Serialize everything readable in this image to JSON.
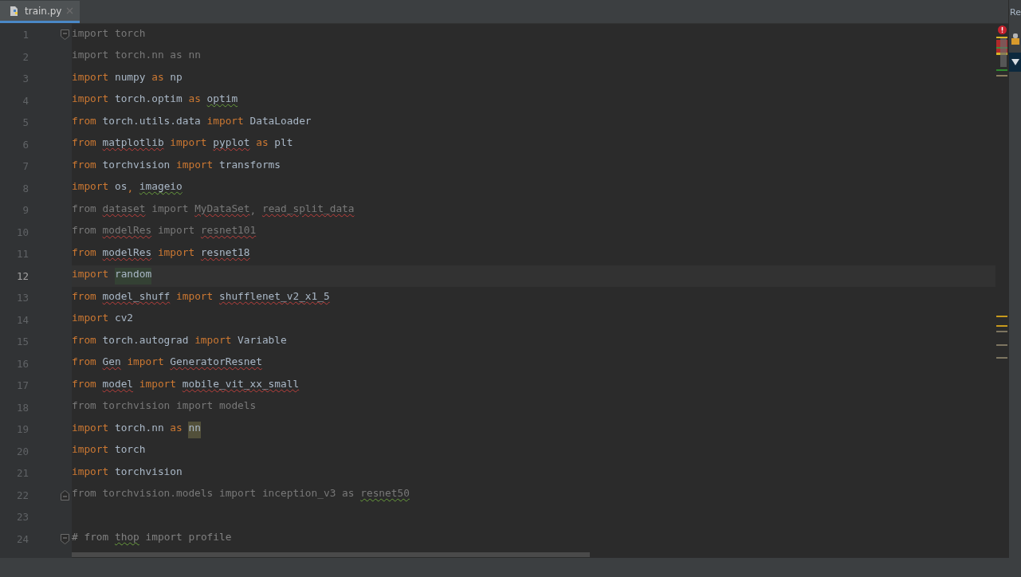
{
  "tab": {
    "label": "train.py",
    "selected": true
  },
  "side_panel": {
    "title": "Re"
  },
  "lines": [
    {
      "number": "1",
      "current": false,
      "fold_start": true,
      "tokens": [
        {
          "text": "import",
          "kind": "unused"
        },
        {
          "text": "torch",
          "kind": "unused"
        }
      ]
    },
    {
      "number": "2",
      "current": false,
      "tokens": [
        {
          "text": "import",
          "kind": "unused"
        },
        {
          "text": "torch.nn",
          "kind": "unused"
        },
        {
          "text": "as",
          "kind": "unused"
        },
        {
          "text": "nn",
          "kind": "unused"
        }
      ]
    },
    {
      "number": "3",
      "current": false,
      "tokens": [
        {
          "text": "import",
          "kind": "keyword"
        },
        {
          "text": "numpy",
          "kind": "name"
        },
        {
          "text": "as",
          "kind": "keyword"
        },
        {
          "text": "np",
          "kind": "name"
        }
      ]
    },
    {
      "number": "4",
      "current": false,
      "tokens": [
        {
          "text": "import",
          "kind": "keyword"
        },
        {
          "text": "torch.optim",
          "kind": "name"
        },
        {
          "text": "as",
          "kind": "keyword"
        },
        {
          "text": "optim",
          "kind": "name",
          "warning": true
        }
      ]
    },
    {
      "number": "5",
      "current": false,
      "tokens": [
        {
          "text": "from",
          "kind": "keyword"
        },
        {
          "text": "torch.utils.data",
          "kind": "name"
        },
        {
          "text": "import",
          "kind": "keyword"
        },
        {
          "text": "DataLoader",
          "kind": "name"
        }
      ]
    },
    {
      "number": "6",
      "current": false,
      "tokens": [
        {
          "text": "from",
          "kind": "keyword"
        },
        {
          "text": "matplotlib",
          "kind": "name",
          "error": true
        },
        {
          "text": "import",
          "kind": "keyword"
        },
        {
          "text": "pyplot",
          "kind": "name",
          "error": true
        },
        {
          "text": "as",
          "kind": "keyword"
        },
        {
          "text": "plt",
          "kind": "name"
        }
      ]
    },
    {
      "number": "7",
      "current": false,
      "tokens": [
        {
          "text": "from",
          "kind": "keyword"
        },
        {
          "text": "torchvision",
          "kind": "name"
        },
        {
          "text": "import",
          "kind": "keyword"
        },
        {
          "text": "transforms",
          "kind": "name"
        }
      ]
    },
    {
      "number": "8",
      "current": false,
      "tokens": [
        {
          "text": "import",
          "kind": "keyword"
        },
        {
          "text": "os",
          "kind": "name",
          "suffix": ","
        },
        {
          "text": "imageio",
          "kind": "name",
          "warning": true
        }
      ]
    },
    {
      "number": "9",
      "current": false,
      "tokens": [
        {
          "text": "from",
          "kind": "unused"
        },
        {
          "text": "dataset",
          "kind": "unused",
          "error": true
        },
        {
          "text": "import",
          "kind": "unused"
        },
        {
          "text": "MyDataSet",
          "kind": "unused",
          "error": true,
          "suffix": ","
        },
        {
          "text": "read_split_data",
          "kind": "unused",
          "error": true
        }
      ]
    },
    {
      "number": "10",
      "current": false,
      "tokens": [
        {
          "text": "from",
          "kind": "unused"
        },
        {
          "text": "modelRes",
          "kind": "unused",
          "error": true
        },
        {
          "text": "import",
          "kind": "unused"
        },
        {
          "text": "resnet101",
          "kind": "unused",
          "error": true
        }
      ]
    },
    {
      "number": "11",
      "current": false,
      "tokens": [
        {
          "text": "from",
          "kind": "keyword"
        },
        {
          "text": "modelRes",
          "kind": "name",
          "error": true
        },
        {
          "text": "import",
          "kind": "keyword"
        },
        {
          "text": "resnet18",
          "kind": "name",
          "error": true
        }
      ]
    },
    {
      "number": "12",
      "current": true,
      "tokens": [
        {
          "text": "import",
          "kind": "keyword"
        },
        {
          "text": "random",
          "kind": "name",
          "highlighted": true
        }
      ]
    },
    {
      "number": "13",
      "current": false,
      "tokens": [
        {
          "text": "from",
          "kind": "keyword"
        },
        {
          "text": "model_shuff",
          "kind": "name",
          "error": true
        },
        {
          "text": "import",
          "kind": "keyword"
        },
        {
          "text": "shufflenet_v2_x1_5",
          "kind": "name",
          "error": true
        }
      ]
    },
    {
      "number": "14",
      "current": false,
      "tokens": [
        {
          "text": "import",
          "kind": "keyword"
        },
        {
          "text": "cv2",
          "kind": "name"
        }
      ]
    },
    {
      "number": "15",
      "current": false,
      "tokens": [
        {
          "text": "from",
          "kind": "keyword"
        },
        {
          "text": "torch.autograd",
          "kind": "name"
        },
        {
          "text": "import",
          "kind": "keyword"
        },
        {
          "text": "Variable",
          "kind": "name"
        }
      ]
    },
    {
      "number": "16",
      "current": false,
      "tokens": [
        {
          "text": "from",
          "kind": "keyword"
        },
        {
          "text": "Gen",
          "kind": "name",
          "error": true
        },
        {
          "text": "import",
          "kind": "keyword"
        },
        {
          "text": "GeneratorResnet",
          "kind": "name",
          "error": true
        }
      ]
    },
    {
      "number": "17",
      "current": false,
      "tokens": [
        {
          "text": "from",
          "kind": "keyword"
        },
        {
          "text": "model",
          "kind": "name",
          "error": true
        },
        {
          "text": "import",
          "kind": "keyword"
        },
        {
          "text": "mobile_vit_xx_small",
          "kind": "name",
          "error": true
        }
      ]
    },
    {
      "number": "18",
      "current": false,
      "tokens": [
        {
          "text": "from",
          "kind": "unused"
        },
        {
          "text": "torchvision",
          "kind": "unused"
        },
        {
          "text": "import",
          "kind": "unused"
        },
        {
          "text": "models",
          "kind": "unused"
        }
      ]
    },
    {
      "number": "19",
      "current": false,
      "tokens": [
        {
          "text": "import",
          "kind": "keyword"
        },
        {
          "text": "torch.nn",
          "kind": "name"
        },
        {
          "text": "as",
          "kind": "keyword"
        },
        {
          "text": "nn",
          "kind": "name",
          "search_match": true
        }
      ]
    },
    {
      "number": "20",
      "current": false,
      "tokens": [
        {
          "text": "import",
          "kind": "keyword"
        },
        {
          "text": "torch",
          "kind": "name"
        }
      ]
    },
    {
      "number": "21",
      "current": false,
      "tokens": [
        {
          "text": "import",
          "kind": "keyword"
        },
        {
          "text": "torchvision",
          "kind": "name"
        }
      ]
    },
    {
      "number": "22",
      "current": false,
      "fold_end": true,
      "tokens": [
        {
          "text": "from",
          "kind": "unused"
        },
        {
          "text": "torchvision.models",
          "kind": "unused"
        },
        {
          "text": "import",
          "kind": "unused"
        },
        {
          "text": "inception_v3",
          "kind": "unused"
        },
        {
          "text": "as",
          "kind": "unused"
        },
        {
          "text": "resnet50",
          "kind": "unused",
          "warning": true
        }
      ]
    },
    {
      "number": "23",
      "current": false
    },
    {
      "number": "24",
      "current": false,
      "fold_start": true,
      "tokens": [
        {
          "text": "#",
          "kind": "comment"
        },
        {
          "text": "from",
          "kind": "comment"
        },
        {
          "text": "thop",
          "kind": "comment",
          "warning": true
        },
        {
          "text": "import",
          "kind": "comment"
        },
        {
          "text": "profile",
          "kind": "comment"
        }
      ]
    }
  ]
}
